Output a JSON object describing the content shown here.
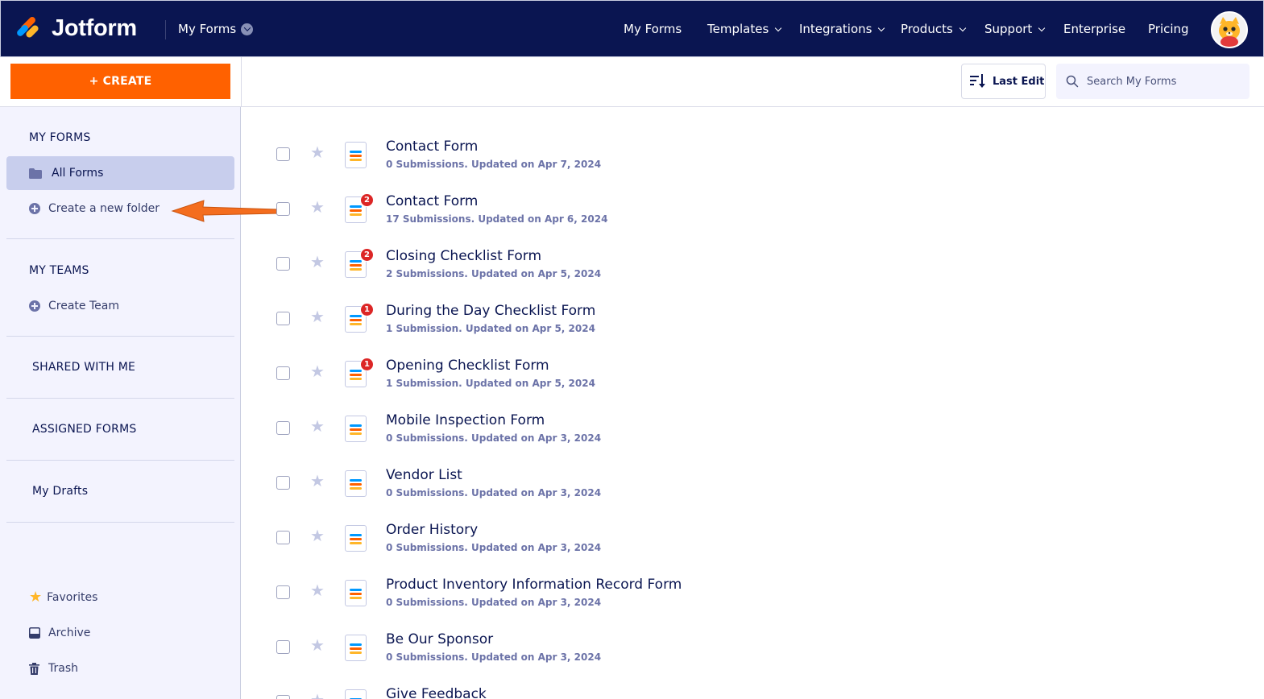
{
  "topbar": {
    "brand": "Jotform",
    "switcher_label": "My Forms",
    "nav": [
      {
        "label": "My Forms",
        "has_dropdown": false
      },
      {
        "label": "Templates",
        "has_dropdown": true
      },
      {
        "label": "Integrations",
        "has_dropdown": true
      },
      {
        "label": "Products",
        "has_dropdown": true
      },
      {
        "label": "Support",
        "has_dropdown": true
      },
      {
        "label": "Enterprise",
        "has_dropdown": false
      },
      {
        "label": "Pricing",
        "has_dropdown": false
      }
    ]
  },
  "actionbar": {
    "create_label": "+ CREATE",
    "sort_label": "Last Edit",
    "search_placeholder": "Search My Forms"
  },
  "sidebar": {
    "my_forms_heading": "MY FORMS",
    "all_forms": "All Forms",
    "create_folder": "Create a new folder",
    "my_teams_heading": "MY TEAMS",
    "create_team": "Create Team",
    "shared_with_me": "SHARED WITH ME",
    "assigned_forms": "ASSIGNED FORMS",
    "my_drafts": "My Drafts",
    "favorites": "Favorites",
    "archive": "Archive",
    "trash": "Trash"
  },
  "forms": [
    {
      "title": "Contact Form",
      "meta": "0 Submissions. Updated on Apr 7, 2024",
      "badge": ""
    },
    {
      "title": "Contact Form",
      "meta": "17 Submissions. Updated on Apr 6, 2024",
      "badge": "2"
    },
    {
      "title": "Closing Checklist Form",
      "meta": "2 Submissions. Updated on Apr 5, 2024",
      "badge": "2"
    },
    {
      "title": "During the Day Checklist Form",
      "meta": "1 Submission. Updated on Apr 5, 2024",
      "badge": "1"
    },
    {
      "title": "Opening Checklist Form",
      "meta": "1 Submission. Updated on Apr 5, 2024",
      "badge": "1"
    },
    {
      "title": "Mobile Inspection Form",
      "meta": "0 Submissions. Updated on Apr 3, 2024",
      "badge": ""
    },
    {
      "title": "Vendor List",
      "meta": "0 Submissions. Updated on Apr 3, 2024",
      "badge": ""
    },
    {
      "title": "Order History",
      "meta": "0 Submissions. Updated on Apr 3, 2024",
      "badge": ""
    },
    {
      "title": "Product Inventory Information Record Form",
      "meta": "0 Submissions. Updated on Apr 3, 2024",
      "badge": ""
    },
    {
      "title": "Be Our Sponsor",
      "meta": "0 Submissions. Updated on Apr 3, 2024",
      "badge": ""
    },
    {
      "title": "Give Feedback",
      "meta": "",
      "badge": ""
    }
  ],
  "colors": {
    "nav_bg": "#0a1551",
    "accent": "#ff6100",
    "sidebar_bg": "#f3f3fe",
    "active_item": "#c8ceed",
    "badge": "#dc2626"
  }
}
